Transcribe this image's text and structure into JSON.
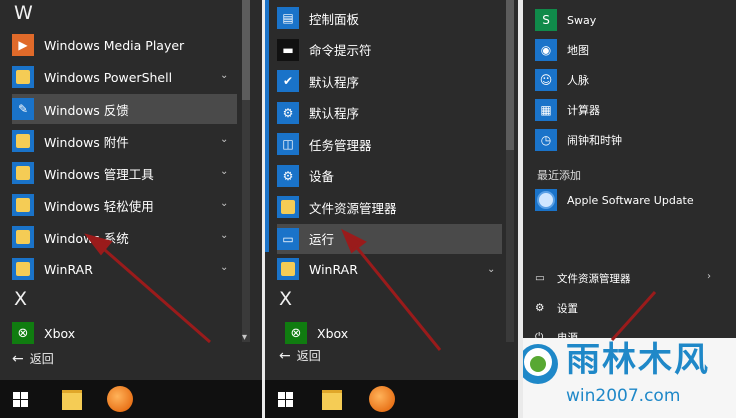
{
  "p1": {
    "letter_w": "W",
    "items": [
      {
        "label": "Windows Media Player",
        "icon": "media-player-icon",
        "chevron": false,
        "hl": false
      },
      {
        "label": "Windows PowerShell",
        "icon": "folder-icon",
        "chevron": true,
        "hl": false
      },
      {
        "label": "Windows 反馈",
        "icon": "feedback-icon",
        "chevron": false,
        "hl": true
      },
      {
        "label": "Windows 附件",
        "icon": "folder-icon",
        "chevron": true,
        "hl": false
      },
      {
        "label": "Windows 管理工具",
        "icon": "folder-icon",
        "chevron": true,
        "hl": false
      },
      {
        "label": "Windows 轻松使用",
        "icon": "folder-icon",
        "chevron": true,
        "hl": false
      },
      {
        "label": "Windows 系统",
        "icon": "folder-icon",
        "chevron": true,
        "hl": false
      },
      {
        "label": "WinRAR",
        "icon": "folder-icon",
        "chevron": true,
        "hl": false
      }
    ],
    "letter_x": "X",
    "xbox": "Xbox",
    "back": "返回"
  },
  "p2": {
    "items": [
      {
        "label": "控制面板",
        "icon": "control-panel-icon"
      },
      {
        "label": "命令提示符",
        "icon": "cmd-icon"
      },
      {
        "label": "默认程序",
        "icon": "default-programs-icon"
      },
      {
        "label": "默认程序",
        "icon": "gear-icon"
      },
      {
        "label": "任务管理器",
        "icon": "task-manager-icon"
      },
      {
        "label": "设备",
        "icon": "gear-icon"
      },
      {
        "label": "文件资源管理器",
        "icon": "folder-icon"
      },
      {
        "label": "运行",
        "icon": "run-icon"
      }
    ],
    "winrar": "WinRAR",
    "letter_x": "X",
    "xbox": "Xbox",
    "back": "返回"
  },
  "p3": {
    "apps": [
      {
        "label": "Sway",
        "icon": "sway-icon"
      },
      {
        "label": "地图",
        "icon": "maps-icon"
      },
      {
        "label": "人脉",
        "icon": "people-icon"
      },
      {
        "label": "计算器",
        "icon": "calculator-icon"
      },
      {
        "label": "闹钟和时钟",
        "icon": "alarm-icon"
      }
    ],
    "recent_header": "最近添加",
    "recent_app": "Apple Software Update",
    "explorer": "文件资源管理器",
    "settings": "设置",
    "power": "电源"
  },
  "watermark": {
    "main": "雨林木风",
    "sub": "win2007.com"
  }
}
